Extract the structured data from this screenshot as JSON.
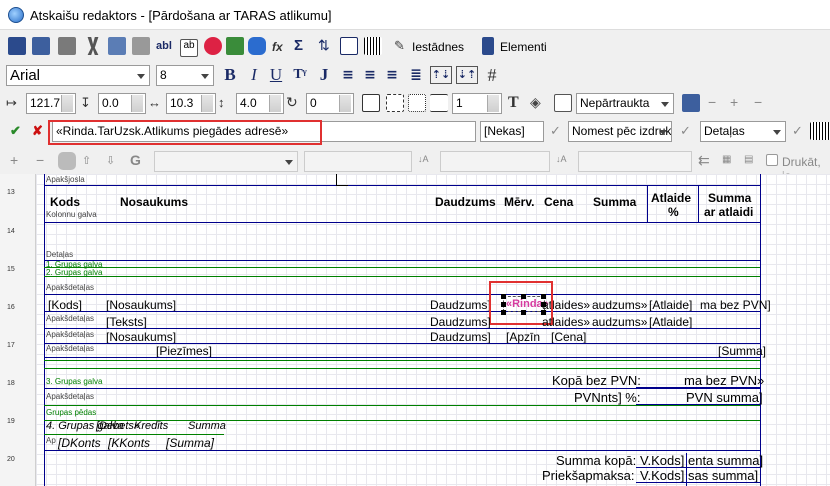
{
  "window": {
    "title": "Atskaišu redaktors - [Pārdošana ar TARAS atlikumu]"
  },
  "toolbar1": {
    "iestadnes": "Iestādnes",
    "elementi": "Elementi"
  },
  "toolbar2": {
    "font": "Arial",
    "size": "8"
  },
  "toolbar3": {
    "left": "121.7",
    "top": "0.0",
    "width": "10.3",
    "height": "4.0",
    "rot": "0",
    "border": "1",
    "line_style": "Nepārtraukta"
  },
  "expr": {
    "value": "«Rinda.TarUzsk.Atlikums piegādes adresē»",
    "null_opt": "[Nekas]",
    "round_opt": "Nomest pēc izdruk",
    "section": "Detaļas"
  },
  "toolbar5": {
    "print_label": "Drukāt, ja"
  },
  "rows": [
    "13",
    "14",
    "15",
    "16",
    "17",
    "18",
    "19",
    "20"
  ],
  "sections": {
    "apaksjosla": "Apakšjosla",
    "kolonnu_galva": "Kolonnu galva",
    "detalas": "Detaļas",
    "grupa1": "1. Grupas galva",
    "grupa2": "2. Grupas galva",
    "apaksdetalas": "Apakšdetaļas",
    "grupa3": "3. Grupas galva",
    "grupas_pedas": "Grupas pēdas",
    "grupa4": "4. Grupas galva"
  },
  "header": {
    "kods": "Kods",
    "nosaukums": "Nosaukums",
    "daudzums": "Daudzums",
    "merv": "Mērv.",
    "cena": "Cena",
    "summa": "Summa",
    "atlaide": "Atlaide",
    "atlaide_pct": "%",
    "summa_ar": "Summa",
    "ar_atlaidi": "ar atlaidi"
  },
  "fields": {
    "kods": "[Kods]",
    "nosaukums": "[Nosaukums]",
    "daudzums1": "Daudzums]",
    "rinda": "«Rinda»",
    "atlaides": "atlaides»",
    "daudzums_s": "audzums»",
    "atlaide": "[Atlaide]",
    "summa_bez": "ma bez PVN]",
    "teksts": "[Teksts]",
    "daudzums2": "Daudzums]",
    "apakslaides": "atlaides»",
    "daudzums_s2": "audzums»",
    "atlaide2": "[Atlaide]",
    "nosaukums2": "[Nosaukums]",
    "daudzums3": "Daudzums]",
    "apzin": "[Apzīn",
    "cena": "[Cena]",
    "summa": "[Summa]",
    "piezimes": "[Piezīmes]",
    "kopa_bez": "Kopā bez PVN:",
    "summa_bez2": "ma bez PVN»",
    "pvnnts": "PVNnts] %:",
    "pvn_summa": "PVN summa]",
    "debets": "[Debets»",
    "kredits": "Kredīts",
    "summa_i": "Summa",
    "dkonts": "[DKonts",
    "kkonts": "[KKonts",
    "summa_i2": "[Summa]",
    "summa_kopa": "Summa kopā:",
    "vkods": "V.Kods]",
    "enta": "enta summa]",
    "prieks": "Priekšapmaksa:",
    "vkods2": "V.Kods]",
    "sas": "sas summa]"
  }
}
